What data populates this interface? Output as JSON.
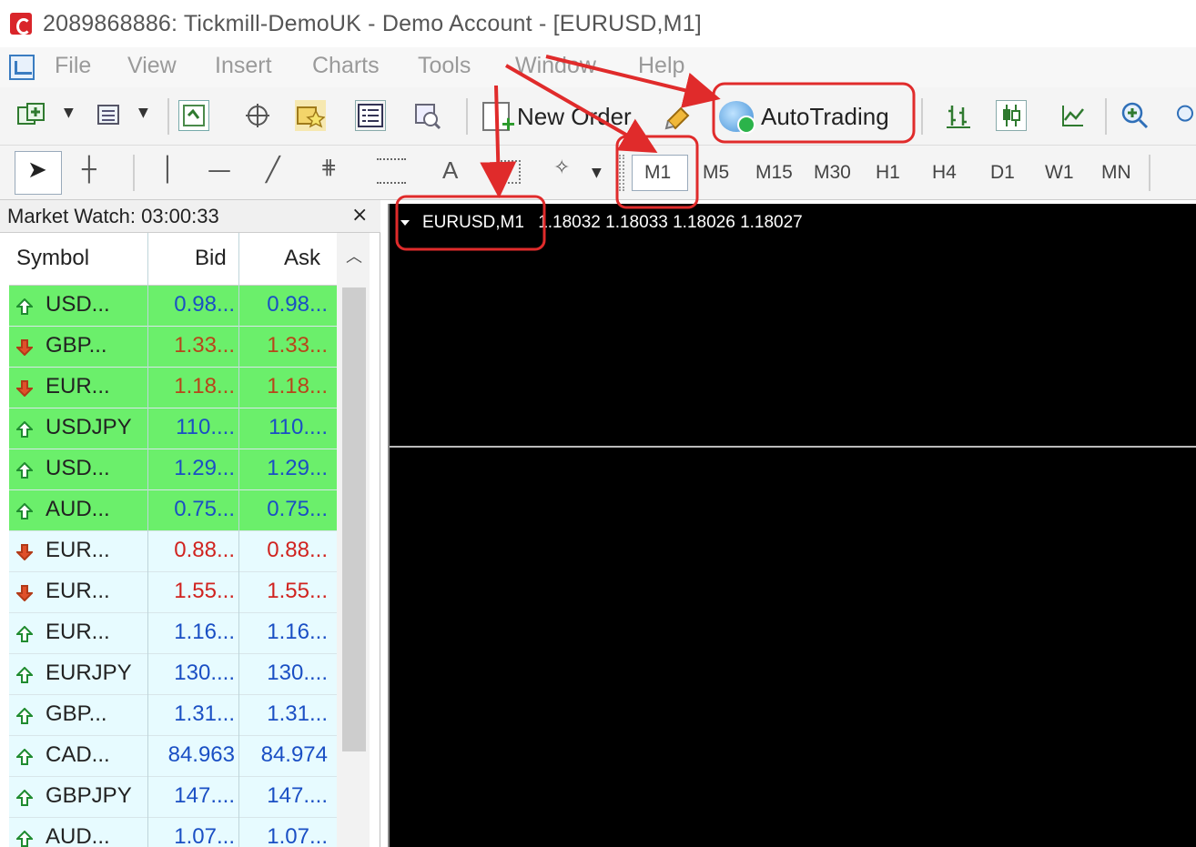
{
  "window": {
    "title": "2089868886: Tickmill-DemoUK - Demo Account - [EURUSD,M1]"
  },
  "menu": {
    "items": [
      "File",
      "View",
      "Insert",
      "Charts",
      "Tools",
      "Window",
      "Help"
    ]
  },
  "toolbar": {
    "new_order_label": "New Order",
    "autotrading_label": "AutoTrading"
  },
  "drawing_toolbar": {
    "text_tool": "A"
  },
  "timeframes": [
    "M1",
    "M5",
    "M15",
    "M30",
    "H1",
    "H4",
    "D1",
    "W1",
    "MN"
  ],
  "market_watch": {
    "title": "Market Watch: 03:00:33",
    "close_glyph": "×",
    "columns": {
      "symbol": "Symbol",
      "bid": "Bid",
      "ask": "Ask"
    },
    "rows": [
      {
        "symbol": "USD...",
        "bid": "0.98...",
        "ask": "0.98...",
        "direction": "up",
        "highlight": "green"
      },
      {
        "symbol": "GBP...",
        "bid": "1.33...",
        "ask": "1.33...",
        "direction": "down",
        "highlight": "green"
      },
      {
        "symbol": "EUR...",
        "bid": "1.18...",
        "ask": "1.18...",
        "direction": "down",
        "highlight": "green"
      },
      {
        "symbol": "USDJPY",
        "bid": "110....",
        "ask": "110....",
        "direction": "up",
        "highlight": "green"
      },
      {
        "symbol": "USD...",
        "bid": "1.29...",
        "ask": "1.29...",
        "direction": "up",
        "highlight": "green"
      },
      {
        "symbol": "AUD...",
        "bid": "0.75...",
        "ask": "0.75...",
        "direction": "up",
        "highlight": "green"
      },
      {
        "symbol": "EUR...",
        "bid": "0.88...",
        "ask": "0.88...",
        "direction": "down",
        "highlight": "light"
      },
      {
        "symbol": "EUR...",
        "bid": "1.55...",
        "ask": "1.55...",
        "direction": "down",
        "highlight": "light"
      },
      {
        "symbol": "EUR...",
        "bid": "1.16...",
        "ask": "1.16...",
        "direction": "up",
        "highlight": "light"
      },
      {
        "symbol": "EURJPY",
        "bid": "130....",
        "ask": "130....",
        "direction": "up",
        "highlight": "light"
      },
      {
        "symbol": "GBP...",
        "bid": "1.31...",
        "ask": "1.31...",
        "direction": "up",
        "highlight": "light"
      },
      {
        "symbol": "CAD...",
        "bid": "84.963",
        "ask": "84.974",
        "direction": "up",
        "highlight": "light"
      },
      {
        "symbol": "GBPJPY",
        "bid": "147....",
        "ask": "147....",
        "direction": "up",
        "highlight": "light"
      },
      {
        "symbol": "AUD...",
        "bid": "1.07...",
        "ask": "1.07...",
        "direction": "up",
        "highlight": "light"
      }
    ]
  },
  "chart": {
    "symbol_label": "EURUSD,M1",
    "quotes": "1.18032 1.18033 1.18026 1.18027"
  },
  "colors": {
    "up_price": "#1a4fc4",
    "down_price_green_row": "#b8451a",
    "down_price_light_row": "#d0231f",
    "up_arrow": "#1f8b2f",
    "down_arrow": "#e0502a",
    "annotation": "#e02b2b"
  }
}
